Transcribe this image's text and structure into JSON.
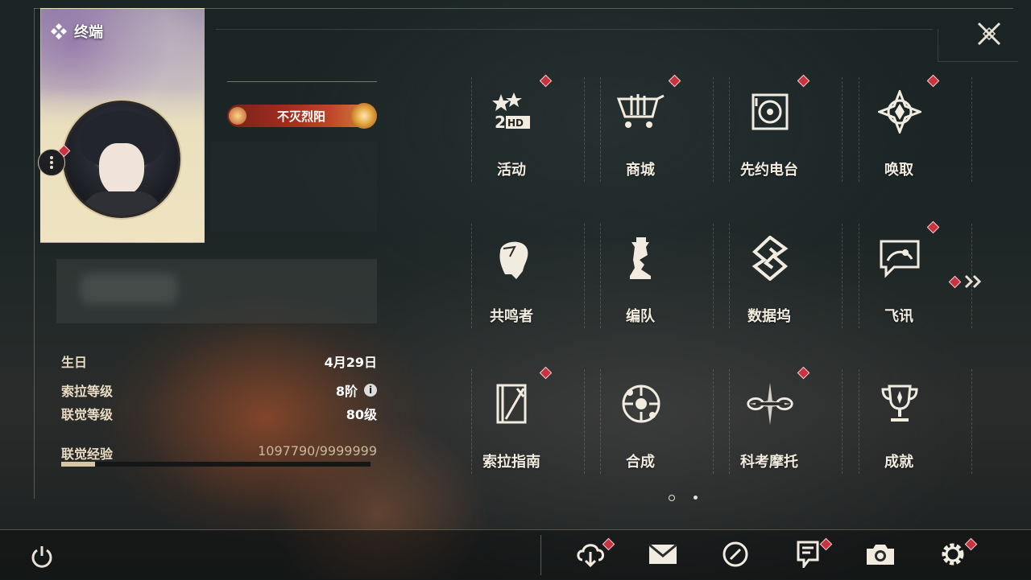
{
  "app": {
    "title": "终端"
  },
  "profile": {
    "title_badge": "不灭烈阳",
    "info": [
      {
        "label": "生日",
        "value": "4月29日"
      },
      {
        "label": "索拉等级",
        "value": "8阶"
      },
      {
        "label": "联觉等级",
        "value": "80级"
      }
    ],
    "info_icon": "i",
    "xp": {
      "label": "联觉经验",
      "value": "1097790/9999999",
      "fraction": 0.11
    }
  },
  "menu": {
    "items": [
      {
        "label": "活动",
        "icon": "event-icon",
        "alert": true
      },
      {
        "label": "商城",
        "icon": "shop-cart-icon",
        "alert": true
      },
      {
        "label": "先约电台",
        "icon": "radio-icon",
        "alert": true
      },
      {
        "label": "唤取",
        "icon": "summon-compass-icon",
        "alert": true
      },
      {
        "label": "共鸣者",
        "icon": "resonator-head-icon",
        "alert": false
      },
      {
        "label": "编队",
        "icon": "team-chess-icon",
        "alert": false
      },
      {
        "label": "数据坞",
        "icon": "data-dock-icon",
        "alert": false
      },
      {
        "label": "飞讯",
        "icon": "message-chat-icon",
        "alert": true
      },
      {
        "label": "索拉指南",
        "icon": "guide-book-icon",
        "alert": true
      },
      {
        "label": "合成",
        "icon": "synthesis-icon",
        "alert": false
      },
      {
        "label": "科考摩托",
        "icon": "motorbike-icon",
        "alert": true
      },
      {
        "label": "成就",
        "icon": "trophy-icon",
        "alert": false
      }
    ],
    "pages": 2,
    "current_page": 1
  },
  "bottom_bar": {
    "items": [
      {
        "name": "download",
        "icon": "cloud-download-icon",
        "alert": true
      },
      {
        "name": "mail",
        "icon": "mail-icon",
        "alert": false
      },
      {
        "name": "clock",
        "icon": "clock-icon",
        "alert": false
      },
      {
        "name": "notice",
        "icon": "notice-icon",
        "alert": true
      },
      {
        "name": "camera",
        "icon": "camera-icon",
        "alert": false
      },
      {
        "name": "settings",
        "icon": "gear-icon",
        "alert": true
      }
    ]
  },
  "colors": {
    "accent": "#d6c6a3",
    "alert": "#c8333f",
    "text": "#ece6d8"
  }
}
